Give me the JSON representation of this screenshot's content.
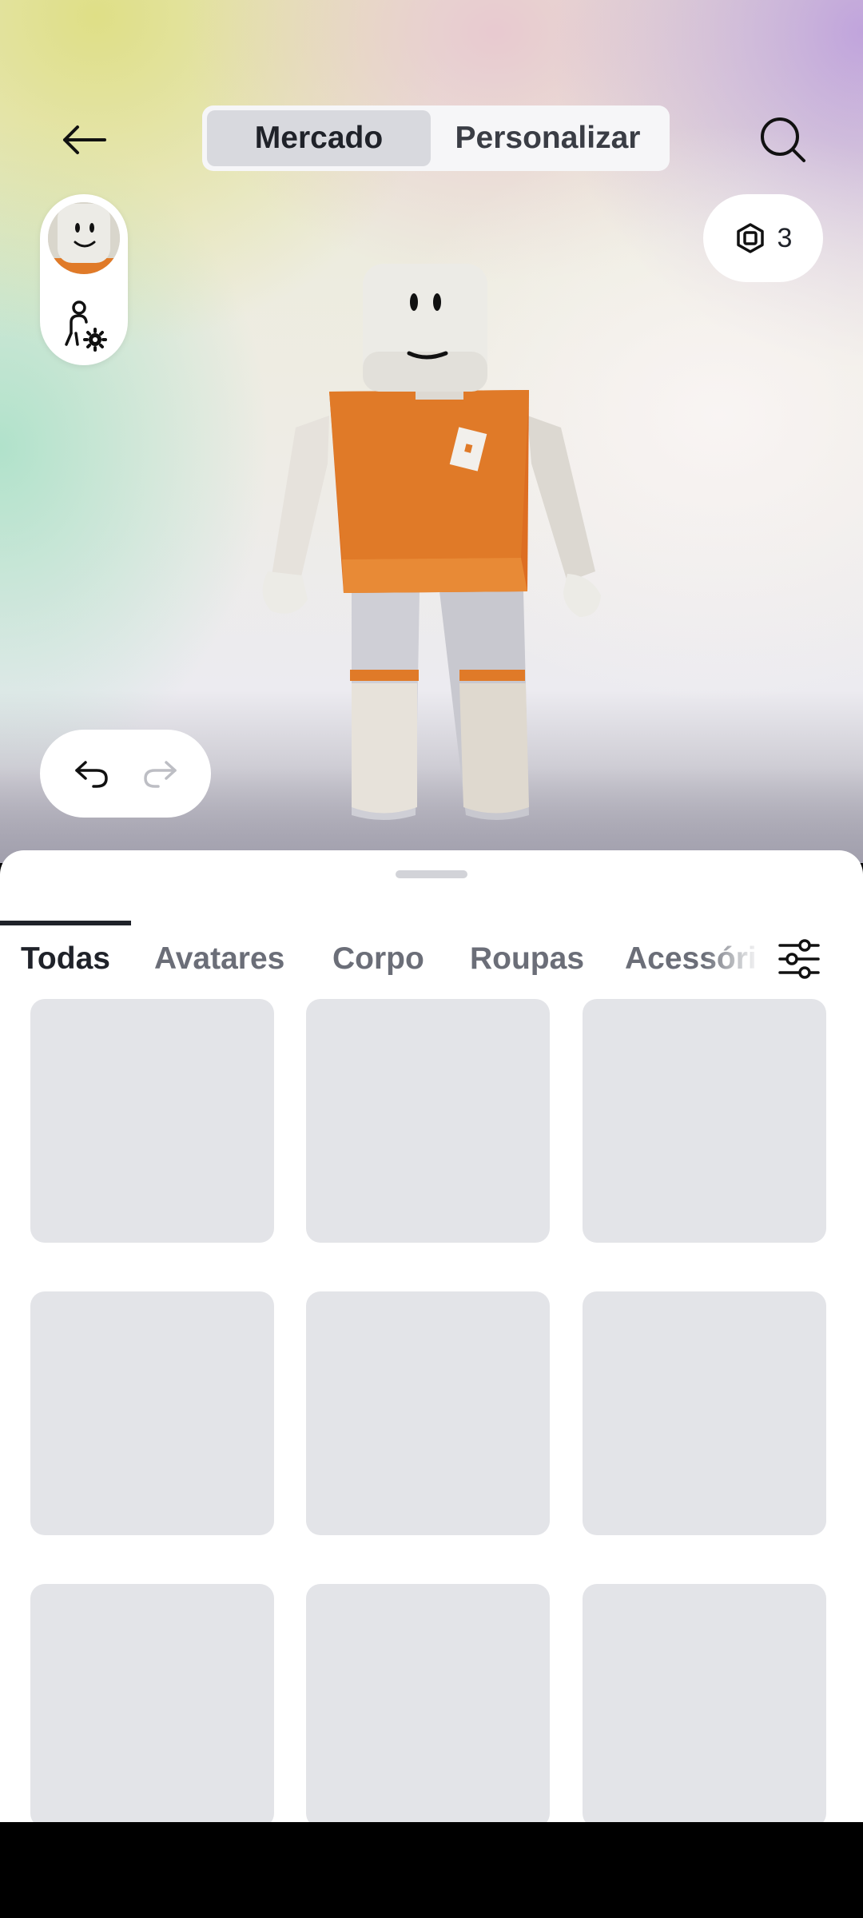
{
  "header": {
    "back_icon": "arrow-left-icon",
    "search_icon": "search-icon",
    "segments": [
      {
        "label": "Mercado",
        "active": true
      },
      {
        "label": "Personalizar",
        "active": false
      }
    ]
  },
  "avatar_panel": {
    "head_icon": "avatar-head-thumbnail",
    "settings_icon": "avatar-settings-icon"
  },
  "currency": {
    "icon": "robux-icon",
    "amount": "3"
  },
  "history": {
    "undo_icon": "undo-icon",
    "redo_icon": "redo-icon"
  },
  "tabs": [
    {
      "label": "Todas",
      "active": true
    },
    {
      "label": "Avatares",
      "active": false
    },
    {
      "label": "Corpo",
      "active": false
    },
    {
      "label": "Roupas",
      "active": false
    },
    {
      "label": "Acessóri",
      "active": false
    }
  ],
  "filter_icon": "sliders-icon",
  "grid": {
    "placeholder_tiles": 9
  },
  "colors": {
    "accent_text": "#1f2229",
    "muted_text": "#6b6e78",
    "tile_placeholder": "#e3e4e8",
    "shirt_orange": "#e07a28"
  }
}
